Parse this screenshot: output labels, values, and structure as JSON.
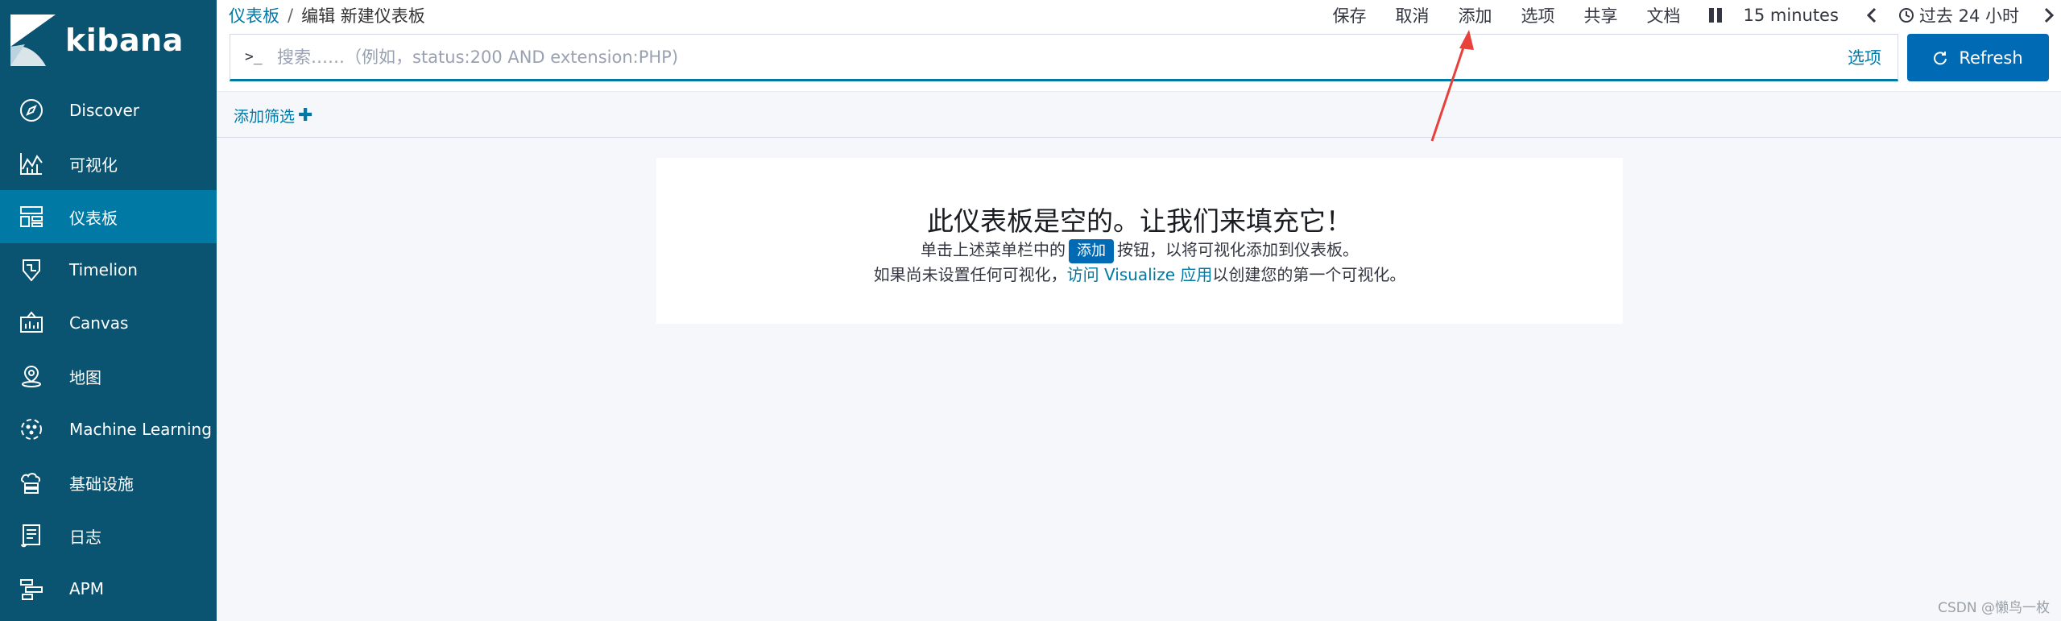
{
  "sidebar": {
    "logo_text": "kibana",
    "items": [
      {
        "label": "Discover",
        "icon": "compass-icon"
      },
      {
        "label": "可视化",
        "icon": "chart-icon"
      },
      {
        "label": "仪表板",
        "icon": "dashboard-icon",
        "active": true
      },
      {
        "label": "Timelion",
        "icon": "timelion-icon"
      },
      {
        "label": "Canvas",
        "icon": "canvas-icon"
      },
      {
        "label": "地图",
        "icon": "map-icon"
      },
      {
        "label": "Machine Learning",
        "icon": "machine-learning-icon"
      },
      {
        "label": "基础设施",
        "icon": "infrastructure-icon"
      },
      {
        "label": "日志",
        "icon": "logs-icon"
      },
      {
        "label": "APM",
        "icon": "apm-icon"
      }
    ]
  },
  "breadcrumb": {
    "root": "仪表板",
    "separator": "/",
    "current": "编辑 新建仪表板"
  },
  "topmenu": {
    "save": "保存",
    "cancel": "取消",
    "add": "添加",
    "options": "选项",
    "share": "共享",
    "docs": "文档",
    "interval": "15 minutes",
    "time_range": "过去 24 小时"
  },
  "query": {
    "prompt": ">_",
    "placeholder": "搜索……（例如，status:200 AND extension:PHP)",
    "value": "",
    "options_label": "选项"
  },
  "refresh_button": {
    "label": "Refresh"
  },
  "filter": {
    "add_label": "添加筛选",
    "plus": "✚"
  },
  "empty_state": {
    "title": "此仪表板是空的。让我们来填充它！",
    "line1_before": "单击上述菜单栏中的",
    "line1_button": "添加",
    "line1_after": "按钮，以将可视化添加到仪表板。",
    "line2_before": "如果尚未设置任何可视化，",
    "line2_link": "访问 Visualize 应用",
    "line2_after": "以创建您的第一个可视化。"
  },
  "watermark": "CSDN @懒鸟一枚",
  "colors": {
    "sidebar_bg": "#0a5471",
    "sidebar_active": "#0079a5",
    "primary": "#006bb4",
    "link": "#0079a5",
    "annotation_arrow": "#e8403a"
  }
}
